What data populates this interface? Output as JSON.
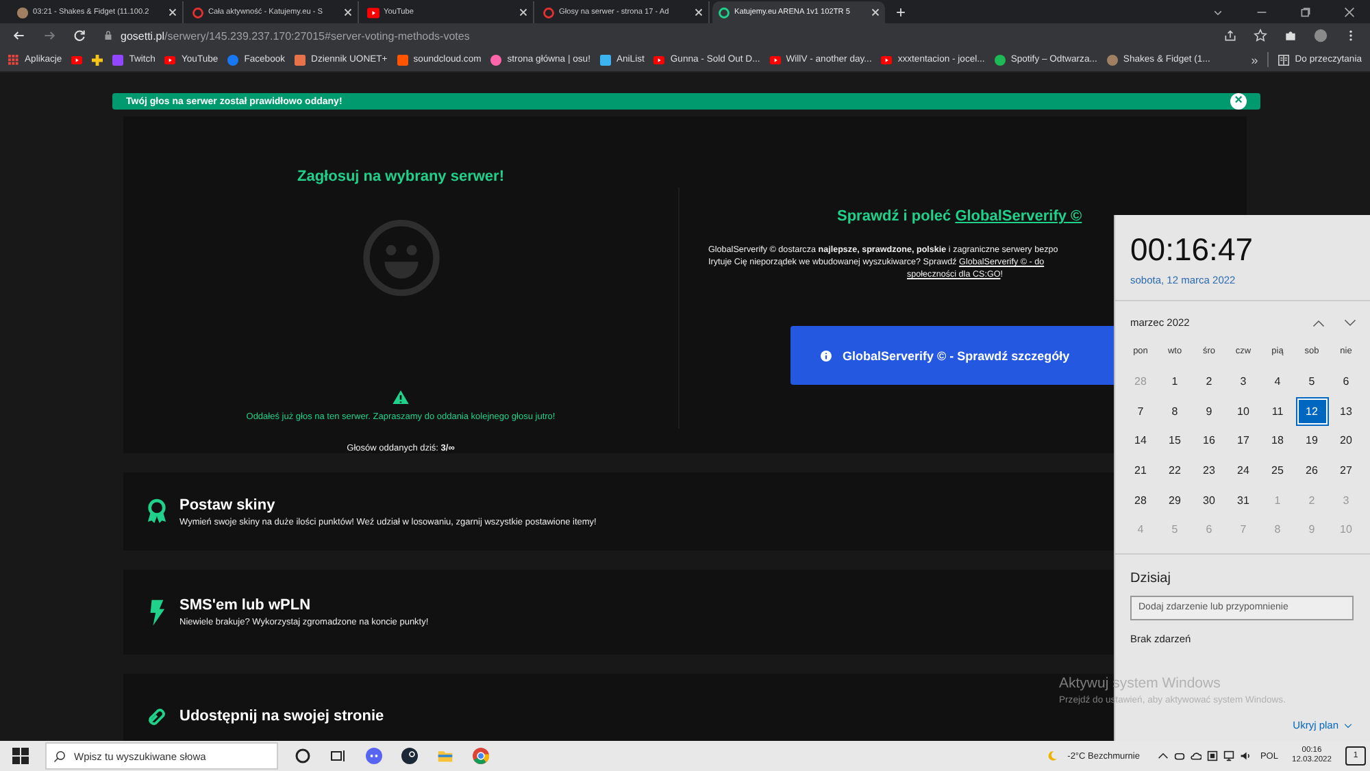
{
  "tabs": [
    {
      "title": "03:21 - Shakes & Fidget (11.100.2",
      "kind": "game",
      "selected": false
    },
    {
      "title": "Cała aktywność - Katujemy.eu - S",
      "kind": "ring",
      "selected": false
    },
    {
      "title": "YouTube",
      "kind": "play",
      "selected": false
    },
    {
      "title": "Głosy na serwer - strona 17 - Ad",
      "kind": "ring",
      "selected": false
    },
    {
      "title": "Katujemy.eu ARENA 1v1 102TR 5",
      "kind": "green-ring",
      "selected": true
    }
  ],
  "new_tab": "+",
  "address": {
    "host": "gosetti.pl",
    "path": "/serwery/145.239.237.170:27015#server-voting-methods-votes"
  },
  "bookmarks": [
    {
      "label": "Aplikacje",
      "color": "#e8453c",
      "kind": "grid"
    },
    {
      "color": "#ff0000",
      "kind": "play"
    },
    {
      "color": "#f5c518",
      "kind": "plus"
    },
    {
      "label": "Twitch",
      "color": "#9146ff",
      "kind": "square"
    },
    {
      "label": "YouTube",
      "color": "#ff0000",
      "kind": "play"
    },
    {
      "label": "Facebook",
      "color": "#1877f2",
      "kind": "circle"
    },
    {
      "label": "Dziennik UONET+",
      "color": "#e8734a",
      "kind": "square"
    },
    {
      "label": "soundcloud.com",
      "color": "#ff5500",
      "kind": "square"
    },
    {
      "label": "strona główna | osu!",
      "color": "#ff66aa",
      "kind": "circle"
    },
    {
      "label": "AniList",
      "color": "#3db4f2",
      "kind": "square"
    },
    {
      "label": "Gunna - Sold Out D...",
      "color": "#ff0000",
      "kind": "play"
    },
    {
      "label": "WillV - another day...",
      "color": "#ff0000",
      "kind": "play"
    },
    {
      "label": "xxxtentacion - jocel...",
      "color": "#ff0000",
      "kind": "play"
    },
    {
      "label": "Spotify – Odtwarza...",
      "color": "#1db954",
      "kind": "circle"
    },
    {
      "label": "Shakes & Fidget (1...",
      "color": "#a08060",
      "kind": "circle"
    }
  ],
  "bookmarks_more": "»",
  "reading_list": "Do przeczytania",
  "alert": {
    "text": "Twój głos na serwer został prawidłowo oddany!",
    "close": "×"
  },
  "vote": {
    "title": "Zagłosuj na wybrany serwer!",
    "warning": "Oddałeś już głos na ten serwer. Zapraszamy do oddania kolejnego głosu jutro!",
    "count": "Głosów oddanych dziś: **3/∞**"
  },
  "promo": {
    "title": "Sprawdź i poleć ",
    "title_link": "GlobalServerify ©",
    "lines": [
      {
        "before": "GlobalServerify © dostarcza **najlepsze, sprawdzone, polskie** i zagraniczne serwery bezpo"
      },
      {
        "before": "Irytuje Cię nieporządek we wbudowanej wyszukiwarce? Sprawdź ",
        "link": "GlobalServerify © - do"
      },
      {
        "link": "społeczności dla CS:GO",
        "after": "!"
      }
    ],
    "button": "GlobalServerify © - Sprawdź szczegóły"
  },
  "sections": [
    {
      "kind": "ribbon",
      "title": "Postaw skiny",
      "description": "Wymień swoje skiny na duże ilości punktów! Weź udział w losowaniu, zgarnij wszystkie postawione itemy!"
    },
    {
      "kind": "bolt",
      "title": "SMS'em lub wPLN",
      "description": "Niewiele brakuje? Wykorzystaj zgromadzone na koncie punkty!"
    },
    {
      "kind": "link",
      "title": "Udostępnij na swojej stronie"
    }
  ],
  "calendar": {
    "time": "00:16:47",
    "date": "sobota, 12 marca 2022",
    "month": "marzec 2022",
    "weekdays": [
      "pon",
      "wto",
      "śro",
      "czw",
      "pią",
      "sob",
      "nie"
    ],
    "days": [
      {
        "day": "28",
        "muted": true,
        "selected": false
      },
      {
        "day": "1",
        "muted": false,
        "selected": false
      },
      {
        "day": "2",
        "muted": false,
        "selected": false
      },
      {
        "day": "3",
        "muted": false,
        "selected": false
      },
      {
        "day": "4",
        "muted": false,
        "selected": false
      },
      {
        "day": "5",
        "muted": false,
        "selected": false
      },
      {
        "day": "6",
        "muted": false,
        "selected": false
      },
      {
        "day": "7",
        "muted": false,
        "selected": false
      },
      {
        "day": "8",
        "muted": false,
        "selected": false
      },
      {
        "day": "9",
        "muted": false,
        "selected": false
      },
      {
        "day": "10",
        "muted": false,
        "selected": false
      },
      {
        "day": "11",
        "muted": false,
        "selected": false
      },
      {
        "day": "12",
        "muted": false,
        "selected": true
      },
      {
        "day": "13",
        "muted": false,
        "selected": false
      },
      {
        "day": "14",
        "muted": false,
        "selected": false
      },
      {
        "day": "15",
        "muted": false,
        "selected": false
      },
      {
        "day": "16",
        "muted": false,
        "selected": false
      },
      {
        "day": "17",
        "muted": false,
        "selected": false
      },
      {
        "day": "18",
        "muted": false,
        "selected": false
      },
      {
        "day": "19",
        "muted": false,
        "selected": false
      },
      {
        "day": "20",
        "muted": false,
        "selected": false
      },
      {
        "day": "21",
        "muted": false,
        "selected": false
      },
      {
        "day": "22",
        "muted": false,
        "selected": false
      },
      {
        "day": "23",
        "muted": false,
        "selected": false
      },
      {
        "day": "24",
        "muted": false,
        "selected": false
      },
      {
        "day": "25",
        "muted": false,
        "selected": false
      },
      {
        "day": "26",
        "muted": false,
        "selected": false
      },
      {
        "day": "27",
        "muted": false,
        "selected": false
      },
      {
        "day": "28",
        "muted": false,
        "selected": false
      },
      {
        "day": "29",
        "muted": false,
        "selected": false
      },
      {
        "day": "30",
        "muted": false,
        "selected": false
      },
      {
        "day": "31",
        "muted": false,
        "selected": false
      },
      {
        "day": "1",
        "muted": true,
        "selected": false
      },
      {
        "day": "2",
        "muted": true,
        "selected": false
      },
      {
        "day": "3",
        "muted": true,
        "selected": false
      },
      {
        "day": "4",
        "muted": true,
        "selected": false
      },
      {
        "day": "5",
        "muted": true,
        "selected": false
      },
      {
        "day": "6",
        "muted": true,
        "selected": false
      },
      {
        "day": "7",
        "muted": true,
        "selected": false
      },
      {
        "day": "8",
        "muted": true,
        "selected": false
      },
      {
        "day": "9",
        "muted": true,
        "selected": false
      },
      {
        "day": "10",
        "muted": true,
        "selected": false
      }
    ],
    "today": "Dzisiaj",
    "event_placeholder": "Dodaj zdarzenie lub przypomnienie",
    "no_events": "Brak zdarzeń",
    "hide_plan": "Ukryj plan"
  },
  "activation": {
    "title": "Aktywuj system Windows",
    "text": "Przejdź do ustawień, aby aktywować system Windows."
  },
  "taskbar": {
    "search_placeholder": "Wpisz tu wyszukiwane słowa",
    "weather": "-2°C Bezchmurnie",
    "language": "POL",
    "time": "00:16",
    "date": "12.03.2022",
    "notifications": "1"
  }
}
